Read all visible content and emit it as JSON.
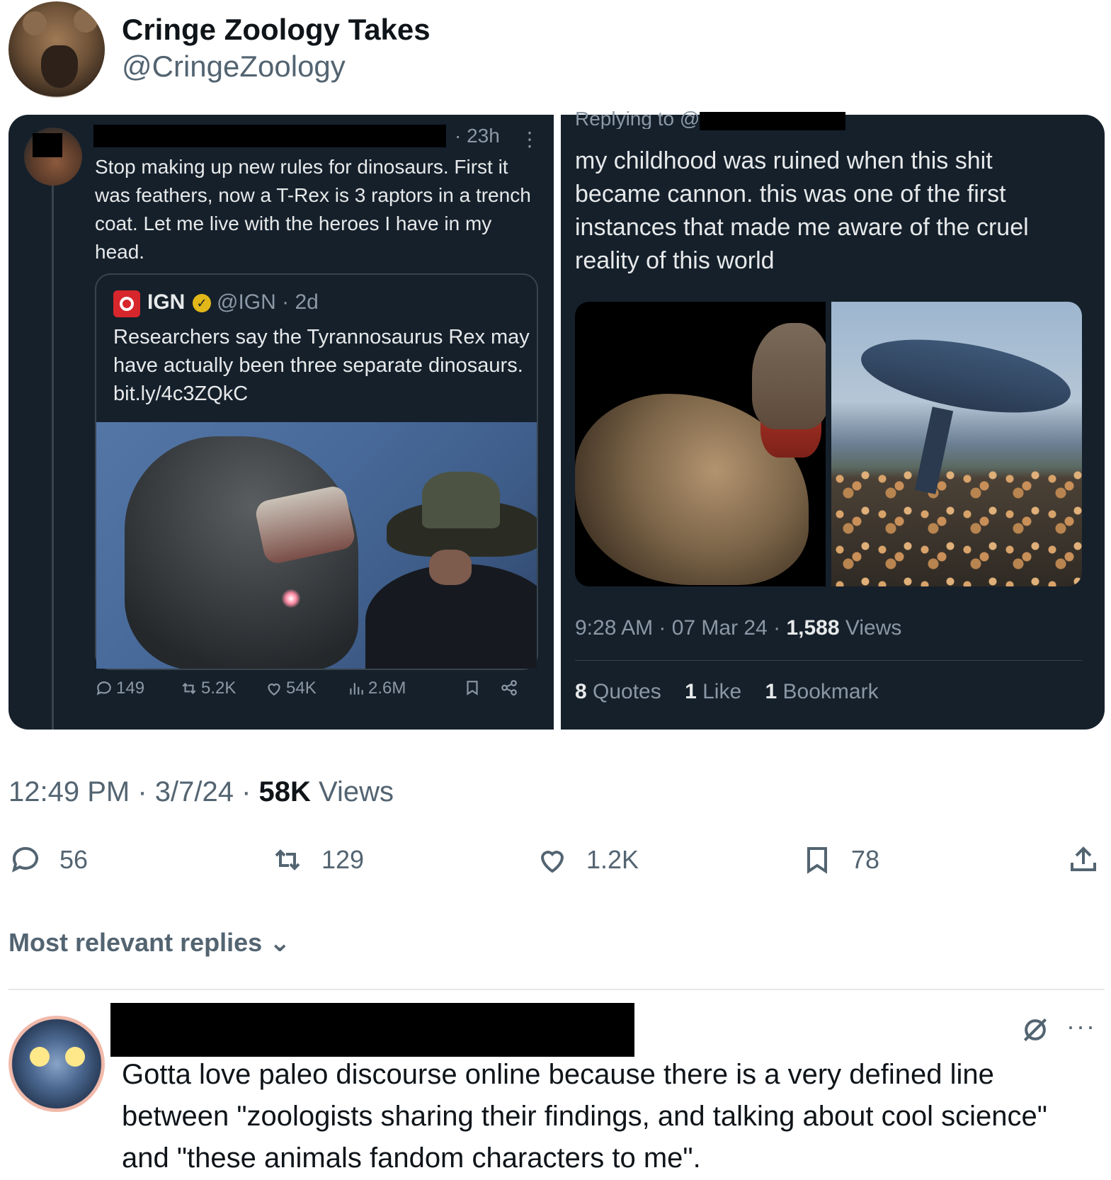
{
  "header": {
    "display_name": "Cringe Zoology Takes",
    "handle": "@CringeZoology"
  },
  "left_tweet": {
    "time": "· 23h",
    "more": "⋮",
    "text": "Stop making up new rules for dinosaurs. First it was feathers, now a T-Rex is 3 raptors in a trench coat. Let me live with the heroes I have in my head.",
    "quote": {
      "name": "IGN",
      "badge": "✓",
      "handle_time": "@IGN · 2d",
      "text": "Researchers say the Tyrannosaurus Rex may have actually been three separate dinosaurs. bit.ly/4c3ZQkC"
    },
    "actions": {
      "replies": "149",
      "reposts": "5.2K",
      "likes": "54K",
      "views": "2.6M"
    }
  },
  "right_tweet": {
    "replying_to": "Replying to @",
    "text": "my childhood was ruined when this shit became cannon. this was one of the first instances that made me aware of the cruel reality of this world",
    "time": "9:28 AM · 07 Mar 24 · ",
    "views_count": "1,588",
    "views_label": " Views",
    "quotes_count": "8",
    "quotes_label": " Quotes",
    "likes_count": "1",
    "likes_label": " Like",
    "bookmarks_count": "1",
    "bookmarks_label": " Bookmark"
  },
  "post_meta": {
    "time": "12:49 PM · 3/7/24 · ",
    "views_count": "58K",
    "views_label": " Views"
  },
  "post_actions": {
    "replies": "56",
    "reposts": "129",
    "likes": "1.2K",
    "bookmarks": "78"
  },
  "replies_sort": {
    "label": "Most relevant replies",
    "chevron": "⌄"
  },
  "reply": {
    "more": "···",
    "text": "Gotta love paleo discourse online because there is a very defined line between \"zoologists sharing their findings, and talking about cool science\" and \"these animals fandom characters to me\"."
  },
  "icons": [
    "reply-icon",
    "repost-icon",
    "like-icon",
    "views-icon",
    "bookmark-icon",
    "share-icon",
    "grok-icon"
  ]
}
